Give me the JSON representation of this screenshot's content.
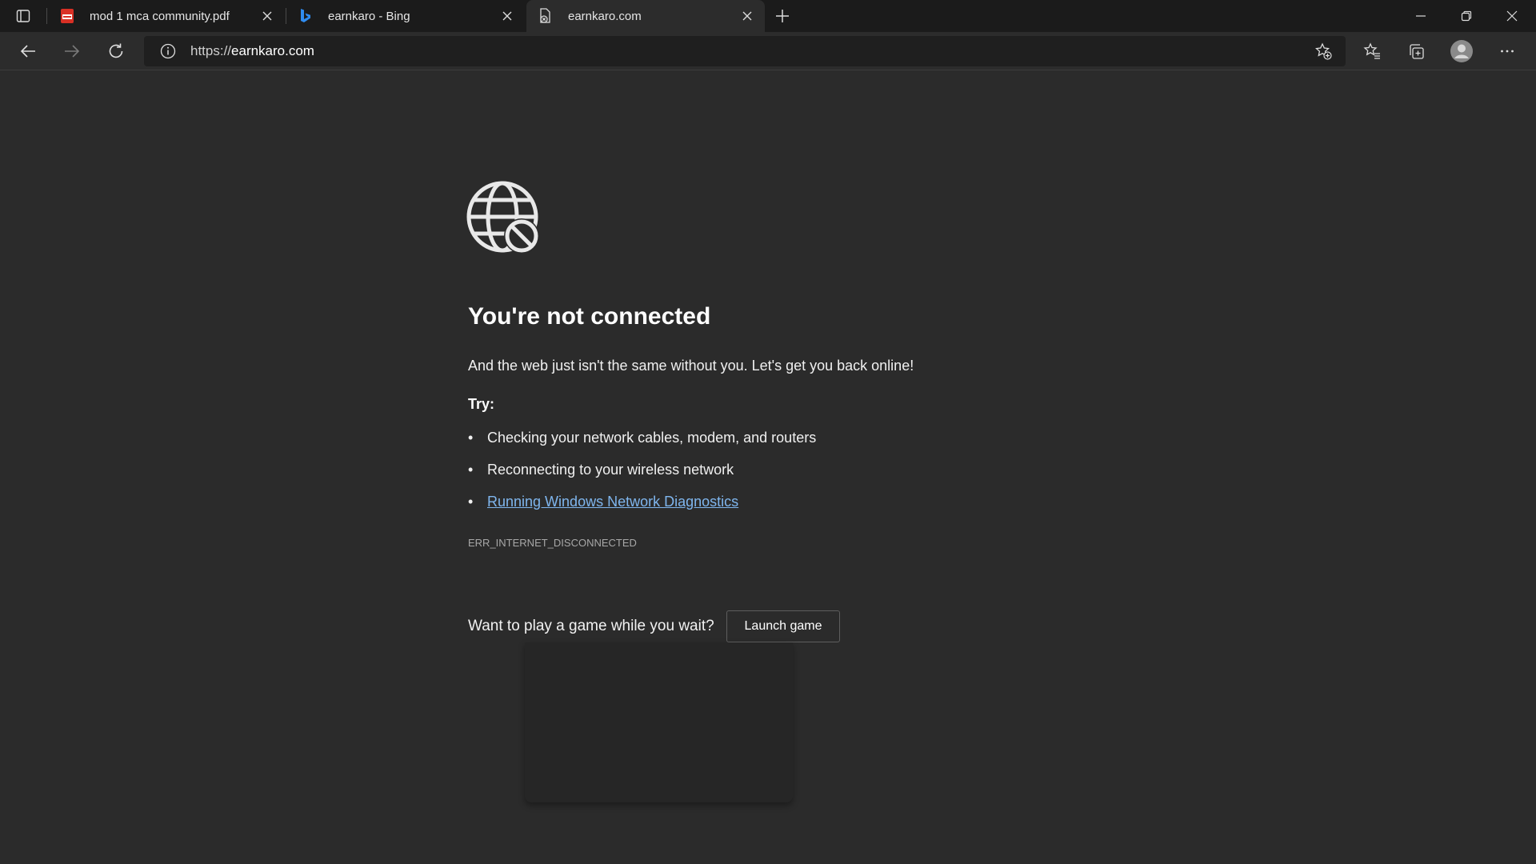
{
  "tabs": [
    {
      "title": "mod 1 mca community.pdf",
      "icon": "pdf-icon",
      "active": false
    },
    {
      "title": "earnkaro - Bing",
      "icon": "bing-icon",
      "active": false
    },
    {
      "title": "earnkaro.com",
      "icon": "page-error-icon",
      "active": true
    }
  ],
  "address": {
    "scheme": "https://",
    "host": "earnkaro.com"
  },
  "error_page": {
    "heading": "You're not connected",
    "subtext": "And the web just isn't the same without you. Let's get you back online!",
    "try_label": "Try:",
    "suggestions": [
      "Checking your network cables, modem, and routers",
      "Reconnecting to your wireless network"
    ],
    "diagnostics_link": "Running Windows Network Diagnostics",
    "error_code": "ERR_INTERNET_DISCONNECTED",
    "game_prompt": "Want to play a game while you wait?",
    "launch_button": "Launch game"
  },
  "colors": {
    "background": "#2b2b2b",
    "tabstrip": "#1b1b1b",
    "link": "#7fb6ee",
    "bing_blue": "#2f8cf0",
    "pdf_red": "#d93025"
  }
}
